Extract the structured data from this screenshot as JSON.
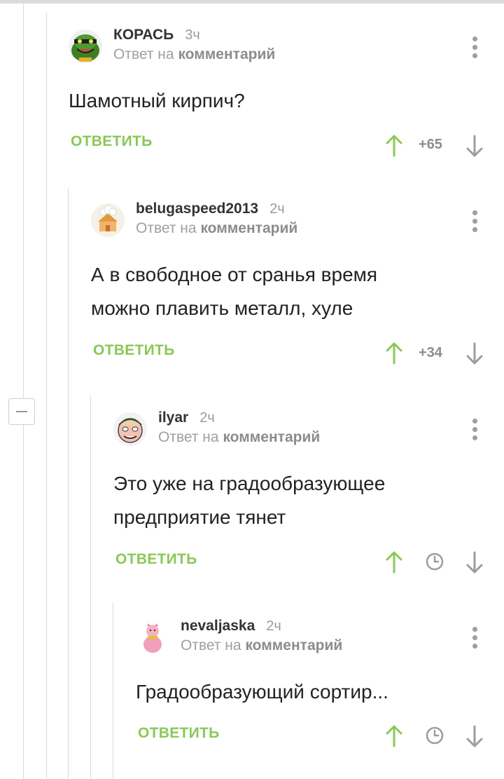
{
  "comments": [
    {
      "author": "КОРАСЬ",
      "time": "3ч",
      "reply_prefix": "Ответ на",
      "reply_target": "комментарий",
      "text_lines": [
        "Шамотный кирпич?"
      ],
      "reply_label": "ОТВЕТИТЬ",
      "rating": "+65",
      "avatar": "frog-avatar-icon"
    },
    {
      "author": "belugaspeed2013",
      "time": "2ч",
      "reply_prefix": "Ответ на",
      "reply_target": "комментарий",
      "text_lines": [
        "А в свободное от сранья время",
        "можно плавить металл, хуле"
      ],
      "reply_label": "ОТВЕТИТЬ",
      "rating": "+34",
      "avatar": "chef-house-avatar-icon"
    },
    {
      "author": "ilyar",
      "time": "2ч",
      "reply_prefix": "Ответ на",
      "reply_target": "комментарий",
      "text_lines": [
        "Это уже на градообразующее",
        "предприятие тянет"
      ],
      "reply_label": "ОТВЕТИТЬ",
      "rating": null,
      "avatar": "cartoon-face-avatar-icon"
    },
    {
      "author": "nevaljaska",
      "time": "2ч",
      "reply_prefix": "Ответ на",
      "reply_target": "комментарий",
      "text_lines": [
        "Градообразующий сортир..."
      ],
      "reply_label": "ОТВЕТИТЬ",
      "rating": null,
      "avatar": "pink-pig-avatar-icon"
    }
  ],
  "colors": {
    "accent_green": "#8ac858",
    "muted_gray": "#9d9d9d",
    "thread_line": "#d9d9d9"
  },
  "icons": [
    "upvote-arrow-icon",
    "downvote-arrow-icon",
    "clock-icon",
    "more-options-icon",
    "collapse-thread-icon"
  ]
}
